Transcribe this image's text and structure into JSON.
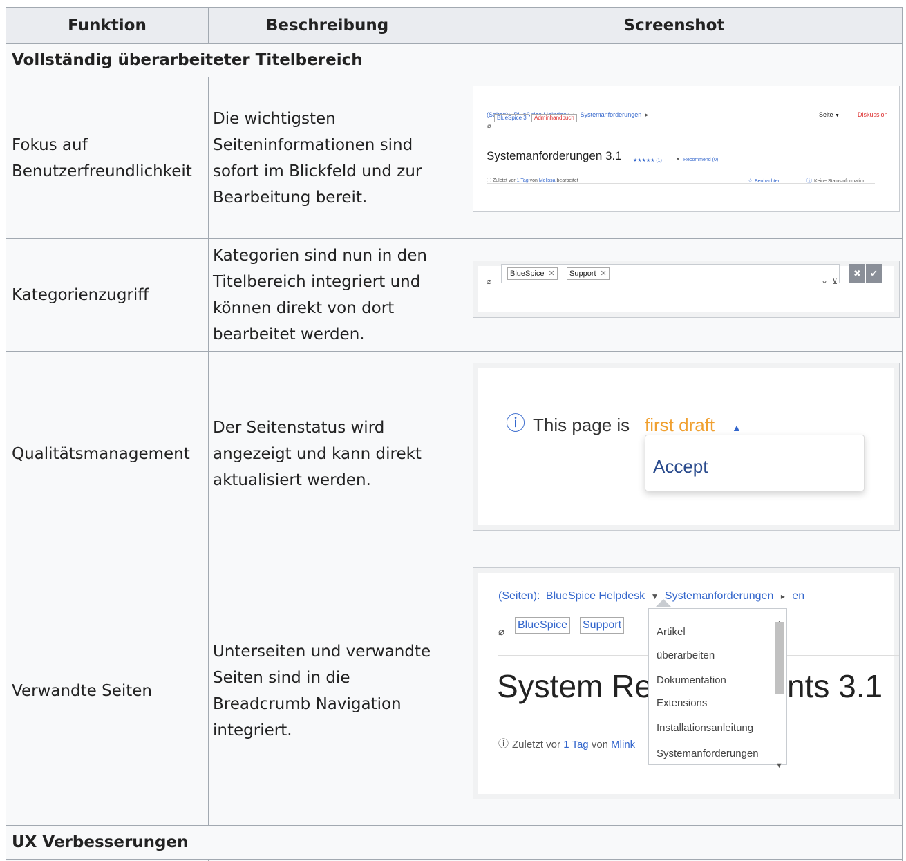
{
  "headers": {
    "col1": "Funktion",
    "col2": "Beschreibung",
    "col3": "Screenshot"
  },
  "section1": "Vollständig überarbeiteter Titelbereich",
  "section2": "UX Verbesserungen",
  "rows": [
    {
      "label": "Fokus auf Benutzerfreundlichkeit",
      "desc": "Die wichtigsten Seiteninformationen sind sofort im Blickfeld und zur Bearbeitung bereit."
    },
    {
      "label": "Kategorienzugriff",
      "desc": "Kategorien sind nun in den Titelbereich integriert und können direkt von dort bearbeitet werden."
    },
    {
      "label": "Qualitätsmanagement",
      "desc": "Der Seitenstatus wird angezeigt und kann direkt aktualisiert werden."
    },
    {
      "label": "Verwandte Seiten",
      "desc": "Unterseiten und verwandte Seiten sind in die Breadcrumb Navigation integriert."
    }
  ],
  "shot1": {
    "crumb_prefix": "(Seiten):",
    "crumb_1": "BlueSpice Helpdesk",
    "crumb_2": "Systemanforderungen",
    "tab_page": "Seite",
    "tab_discussion": "Diskussion",
    "tag_1": "BlueSpice 3",
    "tag_2": "Adminhandbuch",
    "title": "Systemanforderungen 3.1",
    "rating": "★★★★★ (1)",
    "recommend": "Recommend (0)",
    "meta_prefix": "Zuletzt vor",
    "meta_time": "1 Tag",
    "meta_von": "von",
    "meta_user": "Melissa",
    "meta_suffix": "bearbeitet",
    "watch": "Beobachten",
    "status": "Keine Statusinformation"
  },
  "shot2": {
    "tag_1": "BlueSpice",
    "tag_2": "Support"
  },
  "shot3": {
    "status_prefix": "This page is",
    "status_value": "first draft",
    "menu_item": "Accept"
  },
  "shot4": {
    "crumb_prefix": "(Seiten):",
    "crumb_1": "BlueSpice Helpdesk",
    "crumb_2": "Systemanforderungen",
    "crumb_3": "en",
    "tag_1": "BlueSpice",
    "tag_2": "Support",
    "title_left": "System Re",
    "title_right": "nts 3.1",
    "meta_prefix": "Zuletzt vor",
    "meta_time": "1 Tag",
    "meta_von": "von",
    "meta_user": "Mlink",
    "dropdown": [
      "Artikel",
      "überarbeiten",
      "Dokumentation",
      "Extensions",
      "Installationsanleitung",
      "Systemanforderungen"
    ]
  },
  "colors": {
    "link": "#3366cc",
    "red": "#d33333",
    "status_value": "#f0a030",
    "header_bg": "#eaecf0",
    "cell_bg": "#f8f9fa"
  }
}
